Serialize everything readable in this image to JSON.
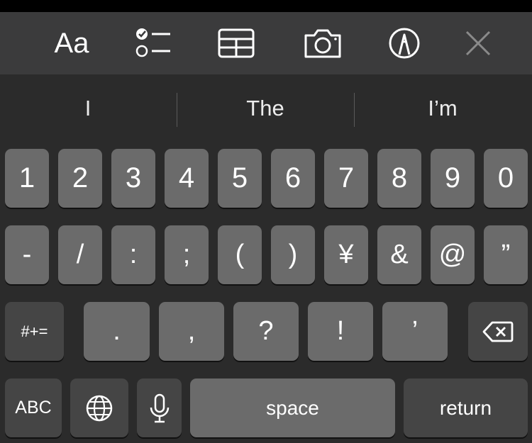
{
  "toolbar": {
    "format_label": "Aa",
    "icons": [
      "checklist-icon",
      "table-icon",
      "camera-icon",
      "markup-icon",
      "close-icon"
    ]
  },
  "predictions": [
    "I",
    "The",
    "I’m"
  ],
  "keyboard": {
    "row1": [
      "1",
      "2",
      "3",
      "4",
      "5",
      "6",
      "7",
      "8",
      "9",
      "0"
    ],
    "row2": [
      "-",
      "/",
      ":",
      ";",
      "(",
      ")",
      "¥",
      "&",
      "@",
      "”"
    ],
    "row3": {
      "mode": "#+=",
      "punct": [
        ".",
        ",",
        "?",
        "!",
        "’"
      ],
      "delete_icon": "delete-icon"
    },
    "row4": {
      "abc": "ABC",
      "globe_icon": "globe-icon",
      "mic_icon": "microphone-icon",
      "space": "space",
      "return": "return"
    }
  }
}
